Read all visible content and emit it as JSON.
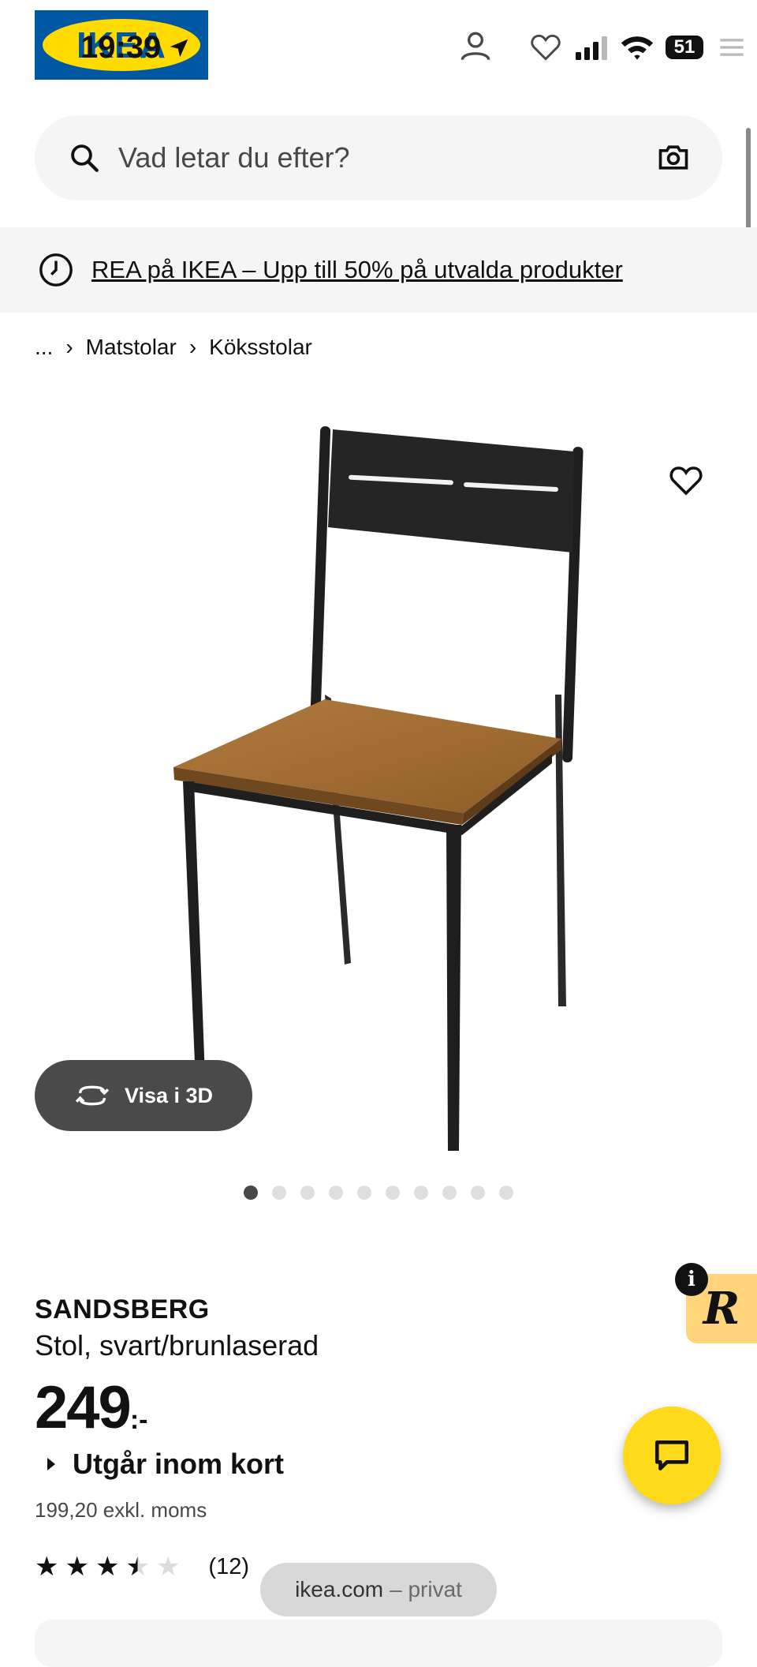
{
  "status_bar": {
    "time": "19:39",
    "battery": "51"
  },
  "header": {
    "logo": "IKEA"
  },
  "search": {
    "placeholder": "Vad letar du efter?"
  },
  "promo": {
    "text": "REA på IKEA – Upp till 50% på utvalda produkter"
  },
  "breadcrumb": {
    "items": [
      "...",
      "Matstolar",
      "Köksstolar"
    ]
  },
  "gallery": {
    "view_3d_label": "Visa i 3D",
    "image_count": 10,
    "active_index": 0
  },
  "product": {
    "name": "SANDSBERG",
    "description": "Stol, svart/brunlaserad",
    "price_int": "249",
    "price_suffix": ":-",
    "availability": "Utgår inom kort",
    "price_excl": "199,20 exkl. moms",
    "rating": 3.5,
    "review_count": "(12)"
  },
  "browser": {
    "domain": "ikea.com",
    "mode": "– privat"
  },
  "colors": {
    "ikea_blue": "#0058a3",
    "ikea_yellow": "#ffdb00",
    "chat_yellow": "#ffda1a"
  }
}
